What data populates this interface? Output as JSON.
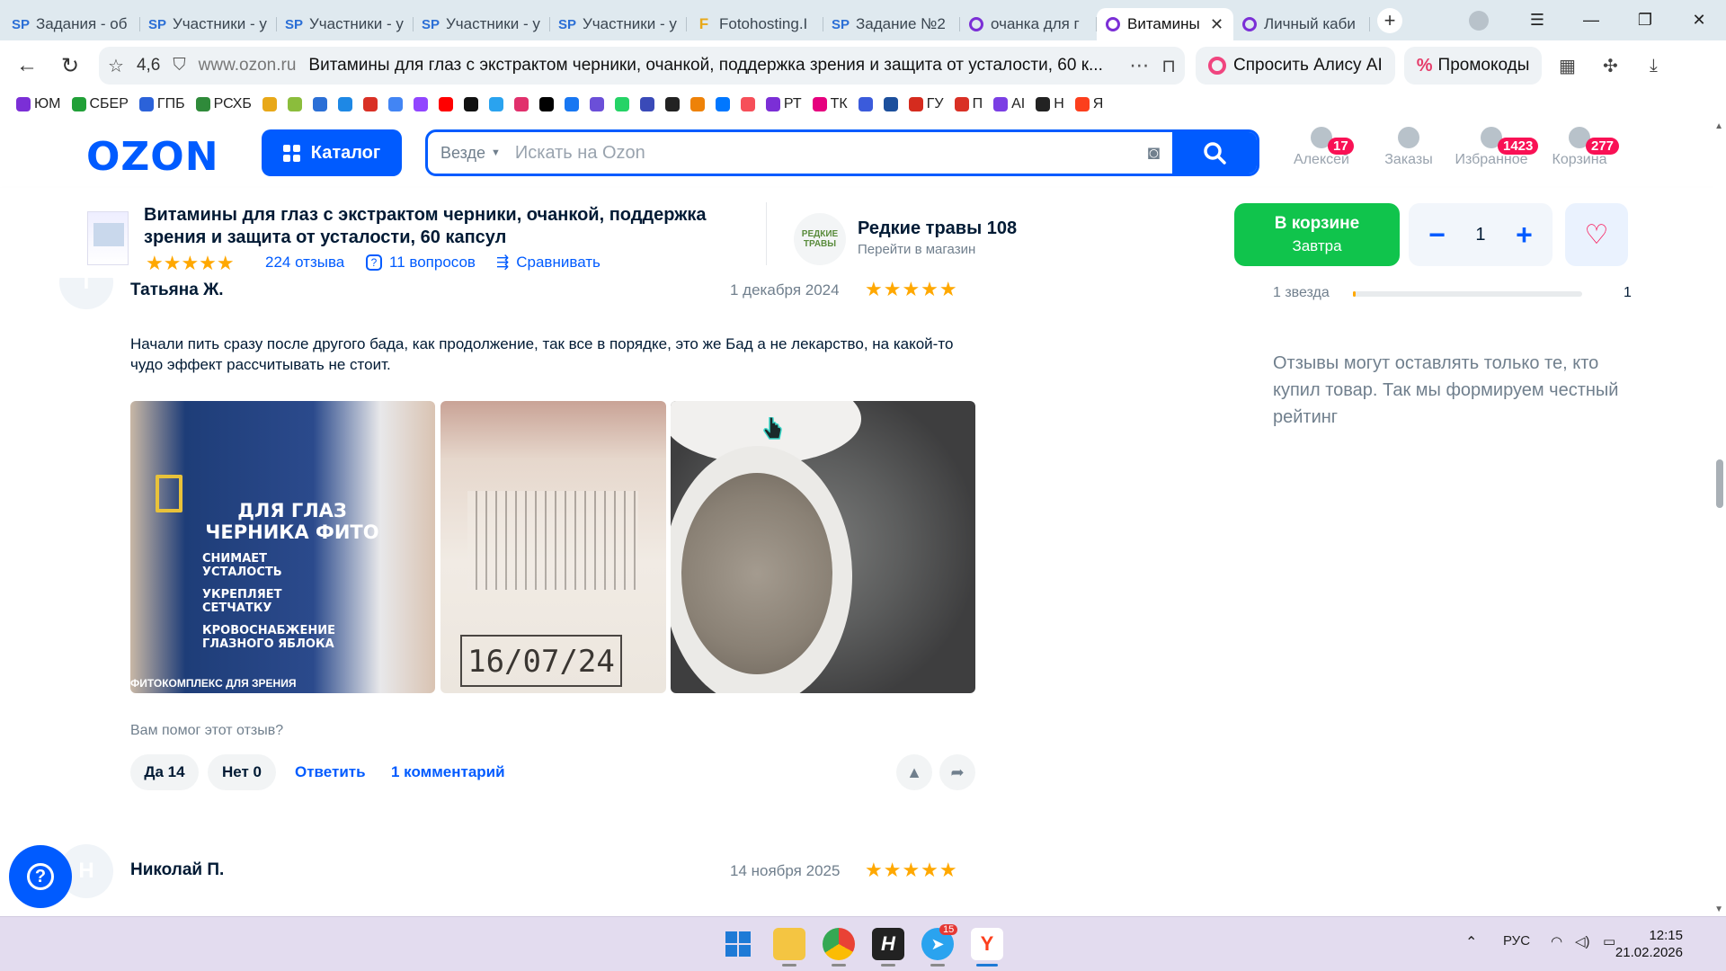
{
  "browser": {
    "tabs": [
      {
        "icon": "sp",
        "label": "Задания - об"
      },
      {
        "icon": "sp",
        "label": "Участники - у"
      },
      {
        "icon": "sp",
        "label": "Участники - у"
      },
      {
        "icon": "sp",
        "label": "Участники - у"
      },
      {
        "icon": "sp",
        "label": "Участники - у"
      },
      {
        "icon": "f",
        "label": "Fotohosting.I"
      },
      {
        "icon": "sp",
        "label": "Задание №2"
      },
      {
        "icon": "ring",
        "label": "очанка для г"
      },
      {
        "icon": "ring",
        "label": "Витамины",
        "active": true
      },
      {
        "icon": "ring",
        "label": "Личный каби"
      }
    ],
    "new_tab": "+",
    "rating": "4,6",
    "host": "www.ozon.ru",
    "page_title": "Витамины для глаз с экстрактом черники, очанкой, поддержка зрения и защита от усталости, 60 к...",
    "alice_label": "Спросить Алису AI",
    "promo_label": "Промокоды",
    "bookmarks": [
      {
        "label": "ЮМ",
        "color": "#7b2fd6"
      },
      {
        "label": "СБЕР",
        "color": "#21a038"
      },
      {
        "label": "ГПБ",
        "color": "#2b62d9"
      },
      {
        "label": "РСХБ",
        "color": "#2f8a3a"
      },
      {
        "label": "",
        "color": "#e8a818"
      },
      {
        "label": "",
        "color": "#8bbd3c"
      },
      {
        "label": "",
        "color": "#2b6fd6"
      },
      {
        "label": "",
        "color": "#1e88e5"
      },
      {
        "label": "",
        "color": "#d93025"
      },
      {
        "label": "",
        "color": "#4285f4"
      },
      {
        "label": "",
        "color": "#9146ff"
      },
      {
        "label": "",
        "color": "#ff0000"
      },
      {
        "label": "",
        "color": "#111111"
      },
      {
        "label": "",
        "color": "#2aa3ef"
      },
      {
        "label": "",
        "color": "#e1306c"
      },
      {
        "label": "",
        "color": "#010101"
      },
      {
        "label": "",
        "color": "#1877f2"
      },
      {
        "label": "",
        "color": "#6b4fd8"
      },
      {
        "label": "",
        "color": "#25d366"
      },
      {
        "label": "",
        "color": "#3a4ab8"
      },
      {
        "label": "",
        "color": "#222222"
      },
      {
        "label": "",
        "color": "#ee8208"
      },
      {
        "label": "",
        "color": "#0077ff"
      },
      {
        "label": "",
        "color": "#f64f59"
      },
      {
        "label": "РТ",
        "color": "#7b2fd6"
      },
      {
        "label": "ТК",
        "color": "#e6007e"
      },
      {
        "label": "",
        "color": "#3b5bdb"
      },
      {
        "label": "",
        "color": "#1c4f9c"
      },
      {
        "label": "ГУ",
        "color": "#d52b1e"
      },
      {
        "label": "П",
        "color": "#d93025"
      },
      {
        "label": "AI",
        "color": "#7b3fe4"
      },
      {
        "label": "Н",
        "color": "#222222"
      },
      {
        "label": "Я",
        "color": "#fc3f1d"
      }
    ]
  },
  "ozon": {
    "logo": "OZON",
    "catalog_label": "Каталог",
    "search_scope": "Везде",
    "search_placeholder": "Искать на Ozon",
    "header_icons": [
      {
        "label": "Алексей",
        "badge": "17"
      },
      {
        "label": "Заказы",
        "badge": ""
      },
      {
        "label": "Избранное",
        "badge": "1423"
      },
      {
        "label": "Корзина",
        "badge": "277"
      }
    ]
  },
  "product": {
    "title": "Витамины для глаз с экстрактом черники, очанкой, поддержка зрения и защита от усталости, 60 капсул",
    "stars": "★★★★★",
    "reviews": "224 отзыва",
    "questions": "11 вопросов",
    "compare": "Сравнивать",
    "shop_logo_text": "РЕДКИЕ ТРАВЫ",
    "shop_name": "Редкие травы 108",
    "shop_link": "Перейти в магазин",
    "cart_line1": "В корзине",
    "cart_line2": "Завтра",
    "qty_minus": "−",
    "qty": "1",
    "qty_plus": "+"
  },
  "reviews": [
    {
      "initial": "Т",
      "author": "Татьяна Ж.",
      "date": "1 декабря 2024",
      "stars": "★★★★★",
      "text": "Начали пить сразу после другого бада, как продолжение, так все в порядке, это же Бад а не лекарство, на какой-то чудо эффект рассчитывать не стоит.",
      "photo1_lines": [
        "ДЛЯ ГЛАЗ",
        "ЧЕРНИКА ФИТО",
        "СНИМАЕТ",
        "УСТАЛОСТЬ",
        "УКРЕПЛЯЕТ",
        "СЕТЧАТКУ",
        "КРОВОСНАБЖЕНИЕ",
        "ГЛАЗНОГО ЯБЛОКА",
        "ФИТОКОМПЛЕКС ДЛЯ ЗРЕНИЯ"
      ],
      "photo2_date": "16/07/24",
      "helpful_question": "Вам помог этот отзыв?",
      "yes": "Да 14",
      "no": "Нет 0",
      "reply": "Ответить",
      "comments": "1 комментарий"
    },
    {
      "initial": "Н",
      "author": "Николай П.",
      "date": "14 ноября 2025",
      "stars": "★★★★★"
    }
  ],
  "sidebar": {
    "rating_row_label": "1 звезда",
    "rating_row_count": "1",
    "rating_row_fraction": 0.01,
    "note": "Отзывы могут оставлять только те, кто купил товар. Так мы формируем честный рейтинг"
  },
  "taskbar": {
    "telegram_badge": "15",
    "lang": "РУС",
    "time": "12:15",
    "date": "21.02.2026"
  }
}
